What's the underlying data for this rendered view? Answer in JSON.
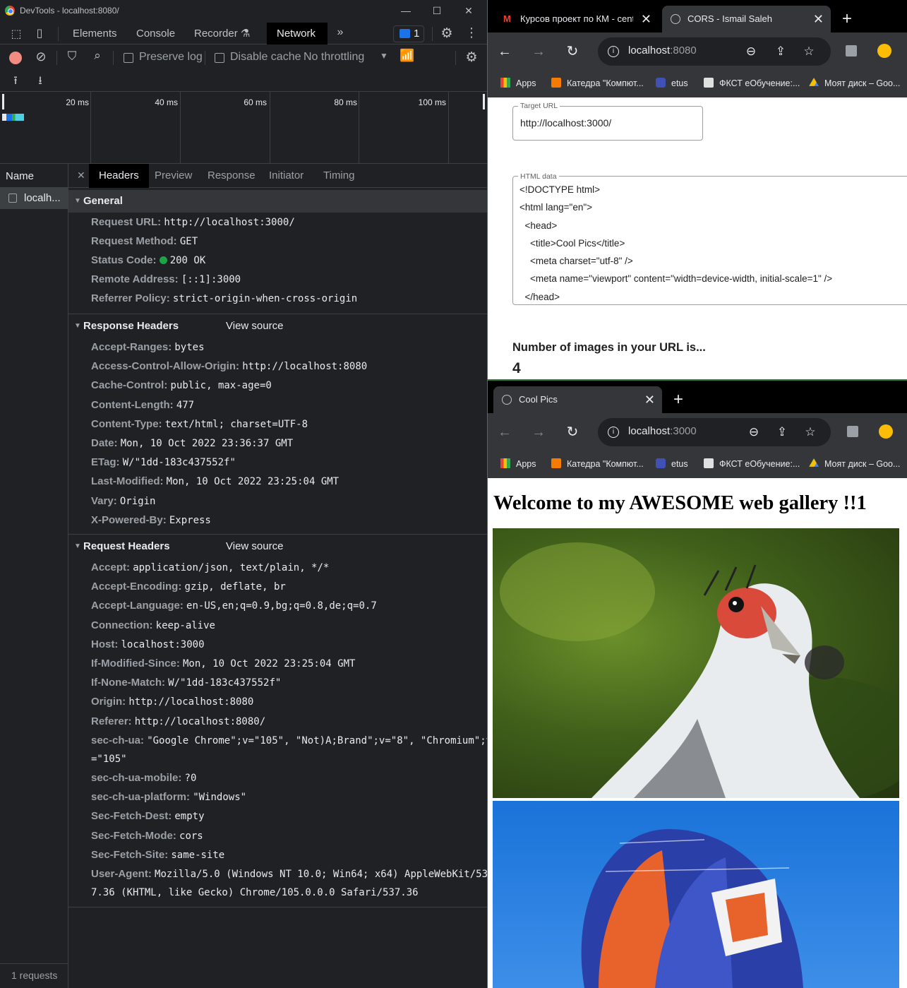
{
  "devtools": {
    "window_title": "DevTools - localhost:8080/",
    "tabs": [
      "Elements",
      "Console",
      "Recorder",
      "Network"
    ],
    "issues_count": "1",
    "toolbar": {
      "preserve_log": "Preserve log",
      "disable_cache": "Disable cache",
      "throttling": "No throttling"
    },
    "timeline_ticks": [
      "20 ms",
      "40 ms",
      "60 ms",
      "80 ms",
      "100 ms"
    ],
    "name_header": "Name",
    "request_name": "localh...",
    "footer": "1 requests",
    "detail_tabs": [
      "Headers",
      "Preview",
      "Response",
      "Initiator",
      "Timing"
    ],
    "view_source": "View source",
    "general": {
      "title": "General",
      "rows": [
        {
          "k": "Request URL:",
          "v": "http://localhost:3000/"
        },
        {
          "k": "Request Method:",
          "v": "GET"
        },
        {
          "k": "Status Code:",
          "v": "200 OK"
        },
        {
          "k": "Remote Address:",
          "v": "[::1]:3000"
        },
        {
          "k": "Referrer Policy:",
          "v": "strict-origin-when-cross-origin"
        }
      ]
    },
    "response_headers": {
      "title": "Response Headers",
      "rows": [
        {
          "k": "Accept-Ranges:",
          "v": "bytes"
        },
        {
          "k": "Access-Control-Allow-Origin:",
          "v": "http://localhost:8080"
        },
        {
          "k": "Cache-Control:",
          "v": "public, max-age=0"
        },
        {
          "k": "Content-Length:",
          "v": "477"
        },
        {
          "k": "Content-Type:",
          "v": "text/html; charset=UTF-8"
        },
        {
          "k": "Date:",
          "v": "Mon, 10 Oct 2022 23:36:37 GMT"
        },
        {
          "k": "ETag:",
          "v": "W/\"1dd-183c437552f\""
        },
        {
          "k": "Last-Modified:",
          "v": "Mon, 10 Oct 2022 23:25:04 GMT"
        },
        {
          "k": "Vary:",
          "v": "Origin"
        },
        {
          "k": "X-Powered-By:",
          "v": "Express"
        }
      ]
    },
    "request_headers": {
      "title": "Request Headers",
      "rows": [
        {
          "k": "Accept:",
          "v": "application/json, text/plain, */*"
        },
        {
          "k": "Accept-Encoding:",
          "v": "gzip, deflate, br"
        },
        {
          "k": "Accept-Language:",
          "v": "en-US,en;q=0.9,bg;q=0.8,de;q=0.7"
        },
        {
          "k": "Connection:",
          "v": "keep-alive"
        },
        {
          "k": "Host:",
          "v": "localhost:3000"
        },
        {
          "k": "If-Modified-Since:",
          "v": "Mon, 10 Oct 2022 23:25:04 GMT"
        },
        {
          "k": "If-None-Match:",
          "v": "W/\"1dd-183c437552f\""
        },
        {
          "k": "Origin:",
          "v": "http://localhost:8080"
        },
        {
          "k": "Referer:",
          "v": "http://localhost:8080/"
        },
        {
          "k": "sec-ch-ua:",
          "v": "\"Google Chrome\";v=\"105\", \"Not)A;Brand\";v=\"8\", \"Chromium\";v",
          "v2": "=\"105\""
        },
        {
          "k": "sec-ch-ua-mobile:",
          "v": "?0"
        },
        {
          "k": "sec-ch-ua-platform:",
          "v": "\"Windows\""
        },
        {
          "k": "Sec-Fetch-Dest:",
          "v": "empty"
        },
        {
          "k": "Sec-Fetch-Mode:",
          "v": "cors"
        },
        {
          "k": "Sec-Fetch-Site:",
          "v": "same-site"
        },
        {
          "k": "User-Agent:",
          "v": "Mozilla/5.0 (Windows NT 10.0; Win64; x64) AppleWebKit/53",
          "v2": "7.36 (KHTML, like Gecko) Chrome/105.0.0.0 Safari/537.36"
        }
      ]
    }
  },
  "bookmarks": [
    "Apps",
    "Катедра \"Компют...",
    "etus",
    "ФКСТ eОбучение:...",
    "Моят диск – Goo..."
  ],
  "browser_top": {
    "tabs": [
      "Курсов проект по КМ - centrif",
      "CORS - Ismail Saleh"
    ],
    "url_host": "localhost",
    "url_port": ":8080",
    "target_url_label": "Target URL",
    "target_url_value": "http://localhost:3000/",
    "html_data_label": "HTML data",
    "html_lines": [
      "<!DOCTYPE html>",
      "<html lang=\"en\">",
      "  <head>",
      "    <title>Cool Pics</title>",
      "    <meta charset=\"utf-8\" />",
      "    <meta name=\"viewport\" content=\"width=device-width, initial-scale=1\" />",
      "  </head>"
    ],
    "images_heading": "Number of images in your URL is...",
    "images_count": "4"
  },
  "browser_bottom": {
    "tab": "Cool Pics",
    "url_host": "localhost",
    "url_port": ":3000",
    "page_heading": "Welcome to my AWESOME web gallery !!1"
  },
  "colors": {
    "devtools_bg": "#202124",
    "status_green": "#1ea446",
    "record_red": "#f28b82",
    "browser_chrome": "#35363a"
  }
}
